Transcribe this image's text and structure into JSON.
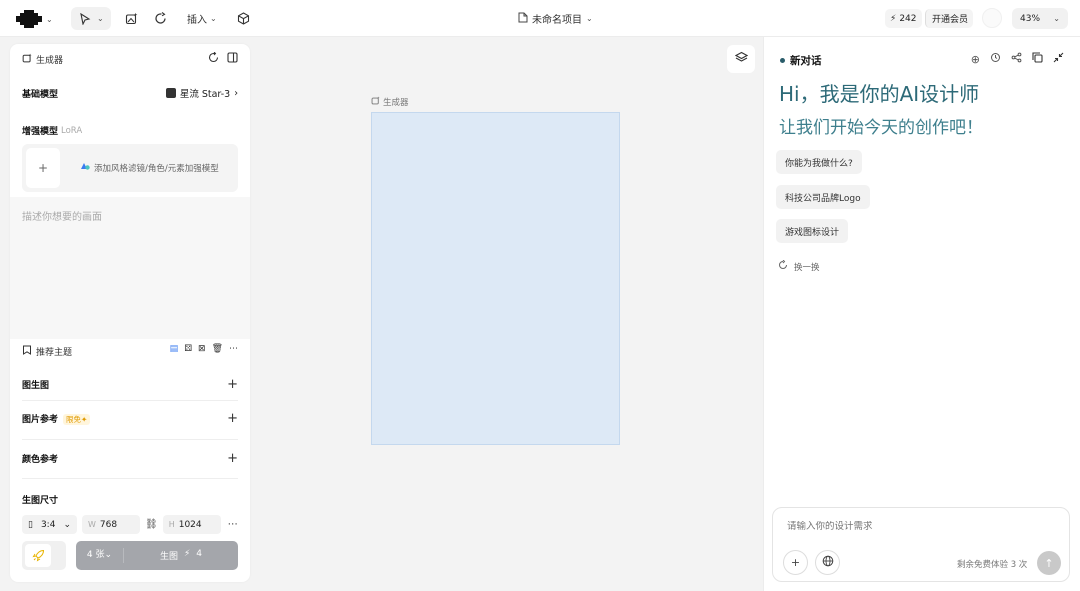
{
  "topbar": {
    "insert_label": "插入",
    "project_title": "未命名项目",
    "credits": "242",
    "vip_label": "开通会员",
    "zoom": "43%"
  },
  "left_panel": {
    "title": "生成器",
    "base_model_label": "基础模型",
    "base_model_value": "星流 Star-3",
    "enhance_label": "增强模型",
    "enhance_tag": "LoRA",
    "lora_add_text": "添加风格滤镜/角色/元素加强模型",
    "prompt_placeholder": "描述你想要的画面",
    "theme_label": "推荐主题",
    "img2img_label": "图生图",
    "img_ref_label": "图片参考",
    "free_tag": "限免",
    "color_ref_label": "颜色参考",
    "size_label": "生图尺寸",
    "ratio": "3:4",
    "width_label": "W",
    "width": "768",
    "height_label": "H",
    "height": "1024",
    "count": "4 张",
    "generate_label": "生图",
    "generate_cost": "4"
  },
  "canvas": {
    "frame_label": "生成器"
  },
  "right_panel": {
    "title": "新对话",
    "greeting": "Hi，我是你的AI设计师",
    "subtitle": "让我们开始今天的创作吧！",
    "suggestions": [
      "你能为我做什么?",
      "科技公司品牌Logo",
      "游戏图标设计"
    ],
    "refresh_label": "换一换",
    "input_placeholder": "请输入你的设计需求",
    "remaining": "剩余免费体验 3 次"
  },
  "colors": {
    "accent_teal": "#2d6a78",
    "frame_fill": "#dde9f6",
    "generate_button": "#a4a6ab",
    "free_tag": "#e09a00"
  }
}
